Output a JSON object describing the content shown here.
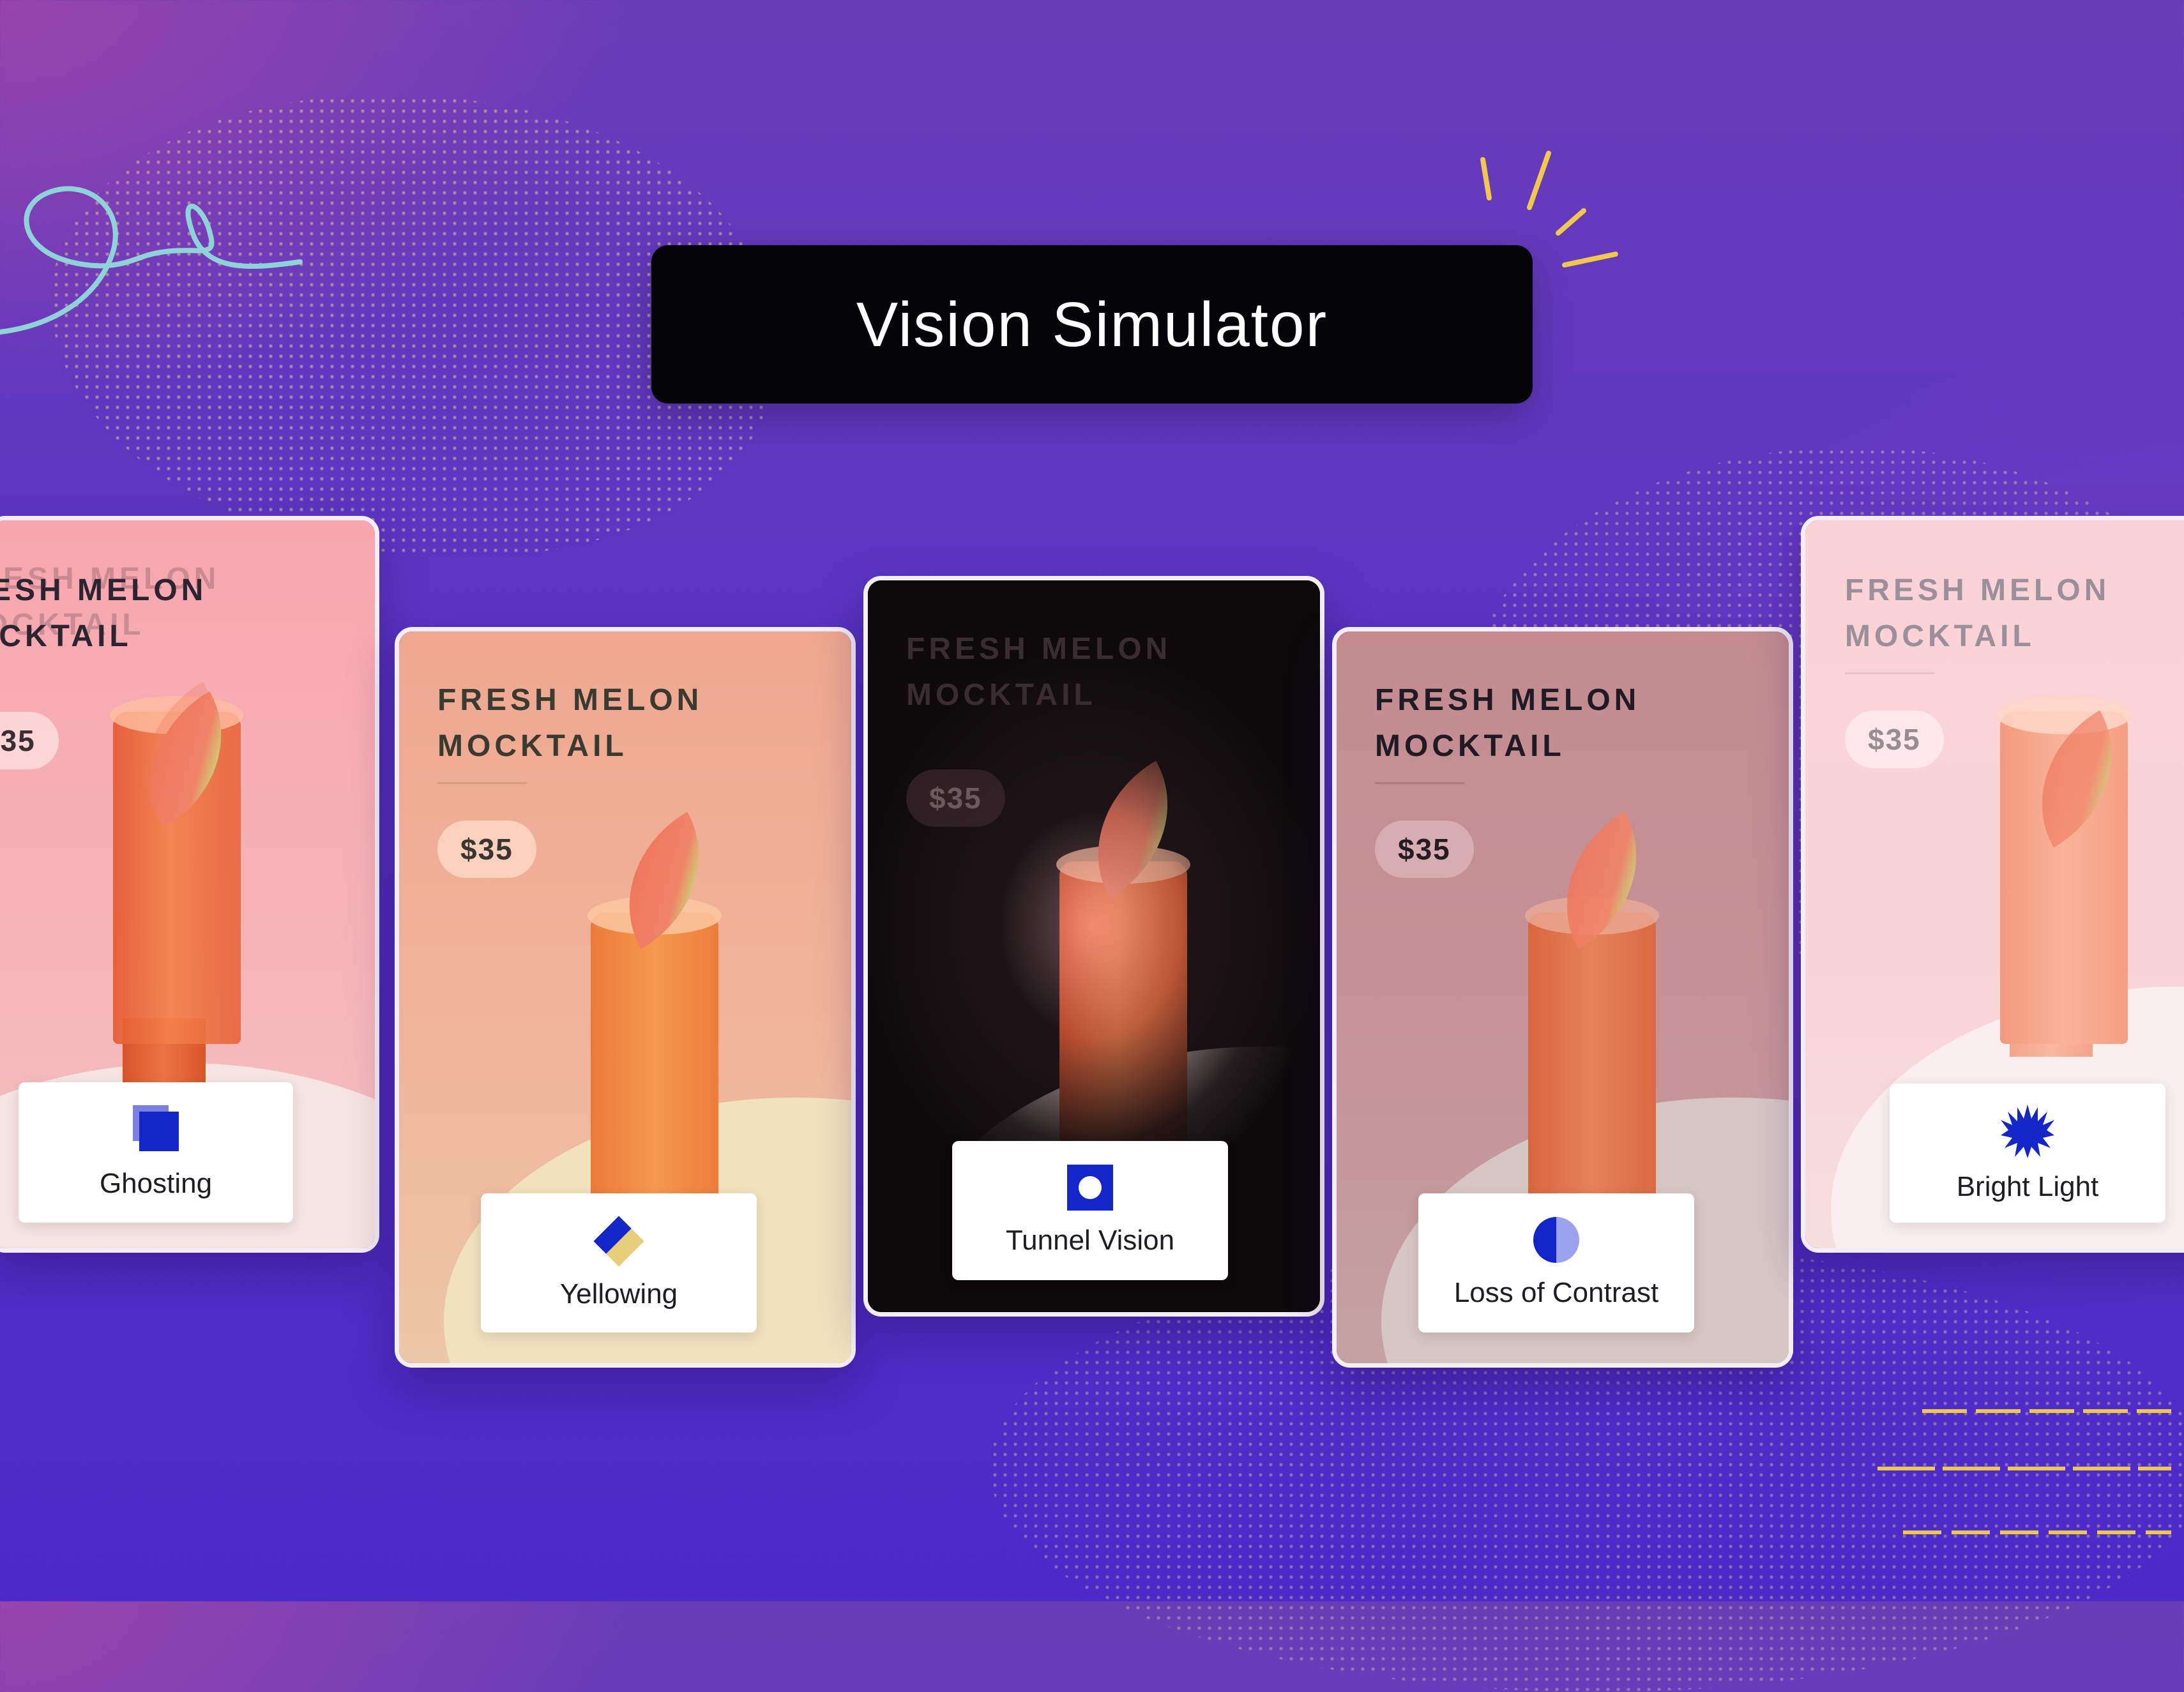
{
  "header": {
    "title": "Vision Simulator"
  },
  "product": {
    "name": "FRESH MELON MOCKTAIL",
    "name_line1": "FRESH MELON",
    "name_line2": "MOCKTAIL",
    "price": "$35"
  },
  "cards": [
    {
      "label": "Ghosting",
      "icon": "ghosting-icon"
    },
    {
      "label": "Yellowing",
      "icon": "yellowing-icon"
    },
    {
      "label": "Tunnel Vision",
      "icon": "tunnel-vision-icon"
    },
    {
      "label": "Loss of Contrast",
      "icon": "loss-of-contrast-icon"
    },
    {
      "label": "Bright Light",
      "icon": "bright-light-icon"
    }
  ],
  "colors": {
    "icon_blue": "#1426c8",
    "title_bar": "#050408",
    "accent_yellow": "#f0c850",
    "accent_teal": "#8fd3d8"
  }
}
